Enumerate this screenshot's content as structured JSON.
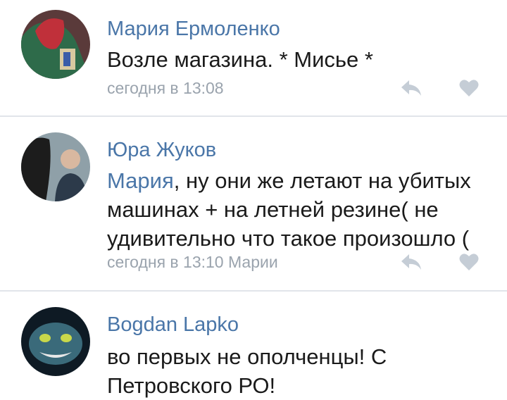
{
  "comments": [
    {
      "author": "Мария Ермоленко",
      "avatar_icon": "user-avatar-red-green",
      "text": "Возле магазина. * Мисье *",
      "time": "сегодня в 13:08"
    },
    {
      "author": "Юра Жуков",
      "avatar_icon": "user-avatar-man",
      "reply_to": "Мария",
      "text": ", ну они же летают на убитых машинах + на летней резине( не удивительно что такое произошло (",
      "time": "сегодня в 13:10 Марии"
    },
    {
      "author": "Bogdan Lapko",
      "avatar_icon": "user-avatar-cheshire-cat",
      "text": "во первых не ополченцы! С Петровского РО!"
    }
  ],
  "colors": {
    "author": "#4a76a8",
    "text": "#1a1a1a",
    "meta": "#9aa3ad",
    "icon": "#c5cdd6",
    "divider": "#e1e5ea"
  }
}
